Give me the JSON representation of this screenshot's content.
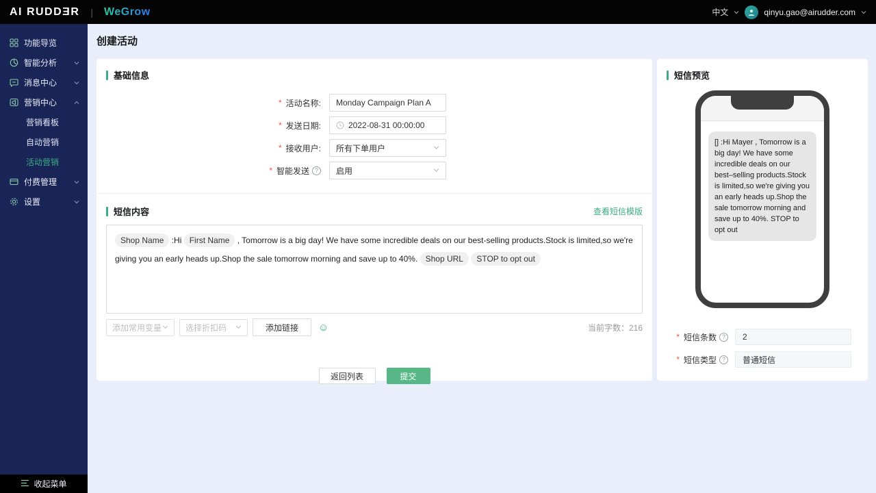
{
  "topbar": {
    "logo": "AI RUDDƎR",
    "divider": "|",
    "product": "WeGrow",
    "language": "中文",
    "user_email": "qinyu.gao@airudder.com"
  },
  "sidebar": {
    "items": [
      {
        "label": "功能导览"
      },
      {
        "label": "智能分析"
      },
      {
        "label": "消息中心"
      },
      {
        "label": "营销中心"
      },
      {
        "label": "付费管理"
      },
      {
        "label": "设置"
      }
    ],
    "sub_items": [
      {
        "label": "营销看板"
      },
      {
        "label": "自动营销"
      },
      {
        "label": "活动营销"
      }
    ],
    "collapse_label": "收起菜单"
  },
  "page": {
    "title": "创建活动"
  },
  "basic_info": {
    "title": "基础信息",
    "name_label": "活动名称:",
    "name_value": "Monday Campaign Plan A",
    "date_label": "发送日期:",
    "date_value": "2022-08-31 00:00:00",
    "audience_label": "接收用户:",
    "audience_value": "所有下单用户",
    "smart_label": "智能发送",
    "smart_value": "启用"
  },
  "sms_content": {
    "title": "短信内容",
    "template_link": "查看短信模版",
    "parts": [
      {
        "text": "Shop Name"
      },
      {
        "text": " :Hi "
      },
      {
        "text": "First Name"
      },
      {
        "text": " , Tomorrow is a big day! We have some incredible deals on our best-selling products.Stock is limited,so we're giving you an early heads up.Shop the sale tomorrow morning and save up to 40%. "
      },
      {
        "text": "Shop URL"
      },
      {
        "text": "STOP to opt out"
      }
    ],
    "variable_placeholder": "添加常用变量",
    "discount_placeholder": "选择折扣码",
    "add_link_label": "添加链接",
    "emoji_icon": "☺",
    "char_count_label": "当前字数：",
    "char_count": "216"
  },
  "actions": {
    "back_label": "返回列表",
    "submit_label": "提交"
  },
  "sms_preview": {
    "title": "短信预览",
    "message": "[] :Hi Mayer , Tomorrow is a big day! We have some incredible deals on our best–selling products.Stock is limited,so we're giving you an early heads up.Shop the sale tomorrow morning and save up to 40%. STOP to opt out",
    "count_label": "短信条数",
    "count_value": "2",
    "type_label": "短信类型",
    "type_value": "普通短信"
  },
  "colors": {
    "accent_green": "#3dab85",
    "submit_green": "#57b787",
    "sidebar_navy": "#1a2557",
    "topbar_black": "#040404",
    "required_red": "#f25643"
  }
}
